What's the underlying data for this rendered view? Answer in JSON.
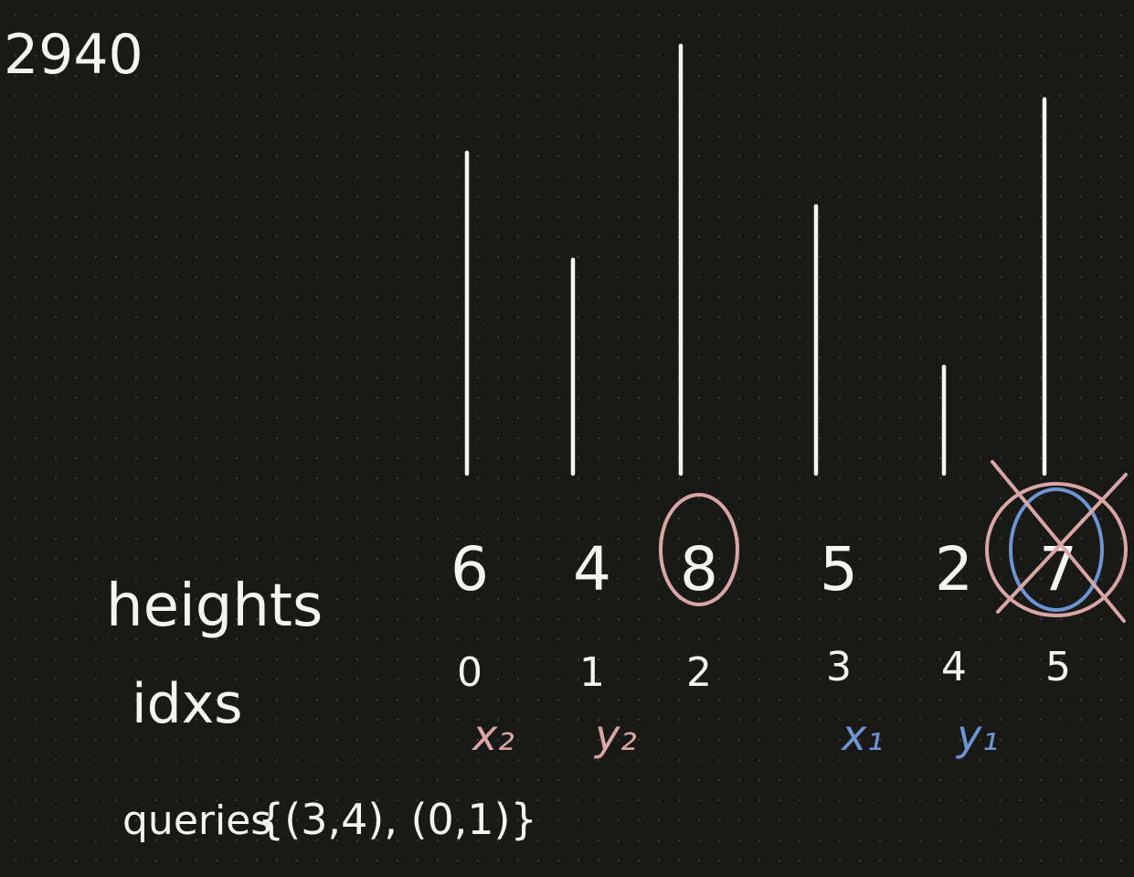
{
  "title": "2940",
  "row_labels": {
    "heights": "heights",
    "idxs": "idxs"
  },
  "bars": [
    {
      "height": 6,
      "height_label": "6",
      "idx_label": "0",
      "pointer": "x₂",
      "pointer_color": "#d9a5a5",
      "circled": false,
      "crossed": false
    },
    {
      "height": 4,
      "height_label": "4",
      "idx_label": "1",
      "pointer": "y₂",
      "pointer_color": "#d9a5a5",
      "circled": false,
      "crossed": false
    },
    {
      "height": 8,
      "height_label": "8",
      "idx_label": "2",
      "pointer": "",
      "pointer_color": "",
      "circled": true,
      "crossed": false
    },
    {
      "height": 5,
      "height_label": "5",
      "idx_label": "3",
      "pointer": "x₁",
      "pointer_color": "#6e94d4",
      "circled": false,
      "crossed": false
    },
    {
      "height": 2,
      "height_label": "2",
      "idx_label": "4",
      "pointer": "y₁",
      "pointer_color": "#6e94d4",
      "circled": false,
      "crossed": false
    },
    {
      "height": 7,
      "height_label": "7",
      "idx_label": "5",
      "pointer": "",
      "pointer_color": "",
      "circled": true,
      "crossed": true
    }
  ],
  "queries": {
    "label": "queries",
    "text": "{(3,4), (0,1)}"
  },
  "colors": {
    "background": "#191917",
    "ink": "#f4f4f0",
    "pink": "#d9a5a5",
    "blue": "#6e94d4"
  }
}
